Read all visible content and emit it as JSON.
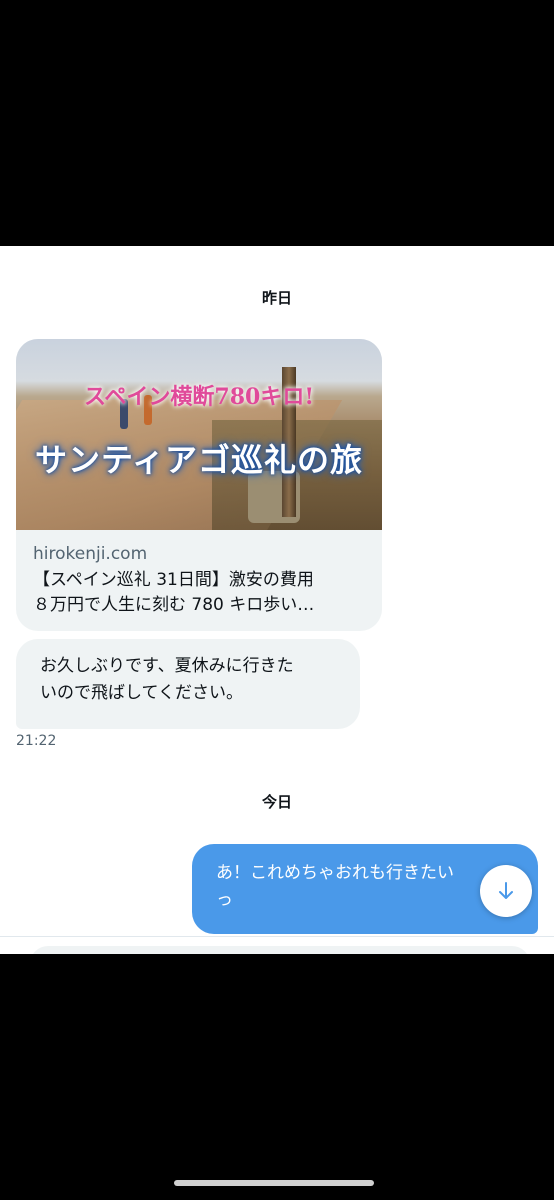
{
  "dates": {
    "yesterday": "昨日",
    "today": "今日"
  },
  "link_card": {
    "image_text_line1": "スペイン横断780キロ!",
    "image_text_line2": "サンティアゴ巡礼の旅",
    "domain": "hirokenji.com",
    "title_line1": "【スペイン巡礼 31日間】激安の費用",
    "title_line2": "８万円で人生に刻む 780 キロ歩い…"
  },
  "messages": {
    "received": {
      "line1": "お久しぶりです、夏休みに行きた",
      "line2": "いので飛ばしてください。",
      "time": "21:22"
    },
    "sent": {
      "line1": "あ！これめちゃおれも行きたい",
      "line2": "っ"
    }
  },
  "icons": {
    "scroll": "arrow-down-icon"
  },
  "colors": {
    "sent_bubble": "#4a99e9",
    "received_bubble": "#eff3f4",
    "secondary_text": "#536471"
  }
}
